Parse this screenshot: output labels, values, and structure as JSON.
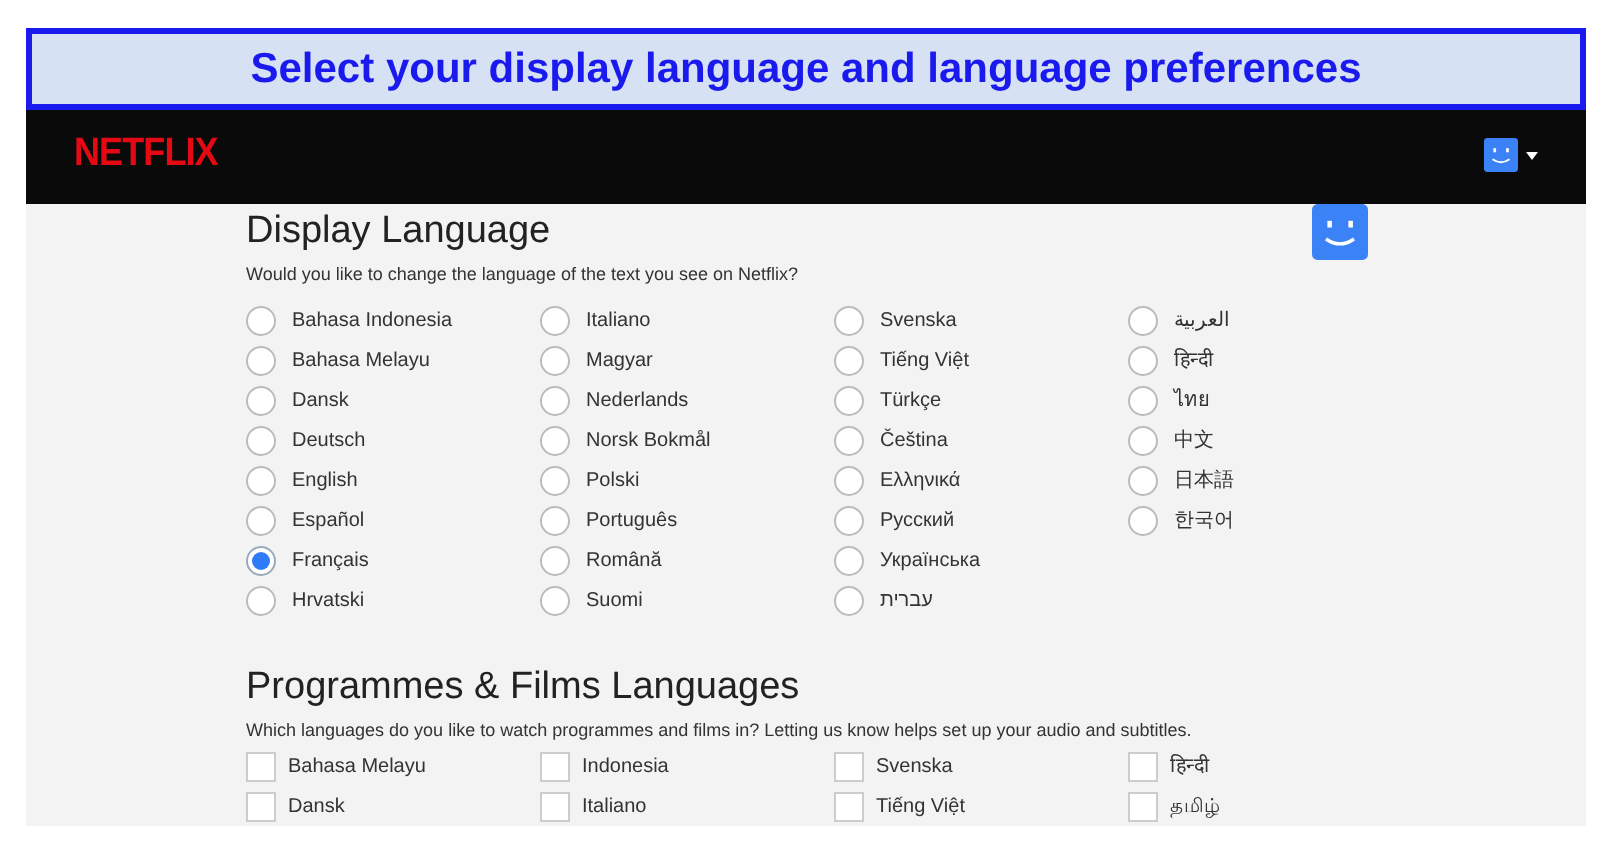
{
  "banner": {
    "title": "Select your display language and language preferences"
  },
  "header": {
    "logo": "NETFLIX"
  },
  "display_language": {
    "title": "Display Language",
    "subtitle": "Would you like to change the language of the text you see on Netflix?",
    "options": [
      {
        "label": "Bahasa Indonesia",
        "selected": false
      },
      {
        "label": "Bahasa Melayu",
        "selected": false
      },
      {
        "label": "Dansk",
        "selected": false
      },
      {
        "label": "Deutsch",
        "selected": false
      },
      {
        "label": "English",
        "selected": false
      },
      {
        "label": "Español",
        "selected": false
      },
      {
        "label": "Français",
        "selected": true
      },
      {
        "label": "Hrvatski",
        "selected": false
      },
      {
        "label": "Italiano",
        "selected": false
      },
      {
        "label": "Magyar",
        "selected": false
      },
      {
        "label": "Nederlands",
        "selected": false
      },
      {
        "label": "Norsk Bokmål",
        "selected": false
      },
      {
        "label": "Polski",
        "selected": false
      },
      {
        "label": "Português",
        "selected": false
      },
      {
        "label": "Română",
        "selected": false
      },
      {
        "label": "Suomi",
        "selected": false
      },
      {
        "label": "Svenska",
        "selected": false
      },
      {
        "label": "Tiếng Việt",
        "selected": false
      },
      {
        "label": "Türkçe",
        "selected": false
      },
      {
        "label": "Čeština",
        "selected": false
      },
      {
        "label": "Ελληνικά",
        "selected": false
      },
      {
        "label": "Русский",
        "selected": false
      },
      {
        "label": "Українська",
        "selected": false
      },
      {
        "label": "עברית",
        "selected": false
      },
      {
        "label": "العربية",
        "selected": false
      },
      {
        "label": "हिन्दी",
        "selected": false
      },
      {
        "label": "ไทย",
        "selected": false
      },
      {
        "label": "中文",
        "selected": false
      },
      {
        "label": "日本語",
        "selected": false
      },
      {
        "label": "한국어",
        "selected": false
      }
    ]
  },
  "programme_languages": {
    "title": "Programmes & Films Languages",
    "subtitle": "Which languages do you like to watch programmes and films in? Letting us know helps set up your audio and subtitles.",
    "options": [
      {
        "label": "Bahasa Melayu",
        "checked": false
      },
      {
        "label": "Dansk",
        "checked": false
      },
      {
        "label": "Indonesia",
        "checked": false
      },
      {
        "label": "Italiano",
        "checked": false
      },
      {
        "label": "Svenska",
        "checked": false
      },
      {
        "label": "Tiếng Việt",
        "checked": false
      },
      {
        "label": "हिन्दी",
        "checked": false
      },
      {
        "label": "தமிழ்",
        "checked": false
      }
    ]
  }
}
